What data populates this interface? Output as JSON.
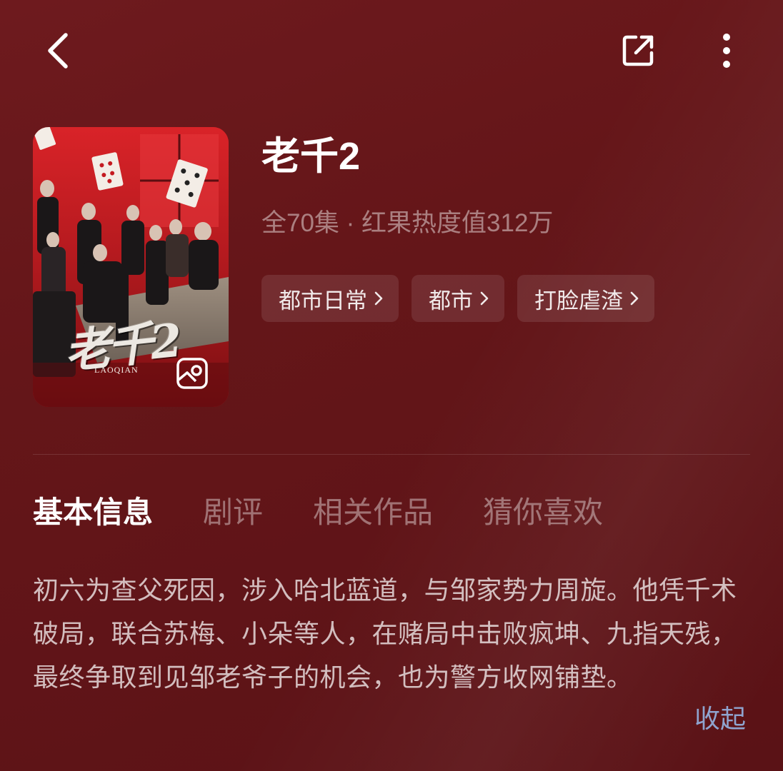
{
  "header": {
    "back_icon": "chevron-left-icon",
    "share_icon": "share-icon",
    "more_icon": "more-vertical-icon"
  },
  "poster": {
    "title_art": "老千2",
    "subtitle_art": "LAOQIAN",
    "gallery_icon": "image-gallery-icon"
  },
  "drama": {
    "title": "老千2",
    "meta": "全70集 · 红果热度值312万",
    "tags": [
      {
        "label": "都市日常"
      },
      {
        "label": "都市"
      },
      {
        "label": "打脸虐渣"
      }
    ]
  },
  "tabs": [
    {
      "label": "基本信息",
      "active": true
    },
    {
      "label": "剧评",
      "active": false
    },
    {
      "label": "相关作品",
      "active": false
    },
    {
      "label": "猜你喜欢",
      "active": false
    }
  ],
  "description": {
    "text": "初六为查父死因，涉入哈北蓝道，与邹家势力周旋。他凭千术破局，联合苏梅、小朵等人，在赌局中击败疯坤、九指天残，最终争取到见邹老爷子的机会，也为警方收网铺垫。",
    "collapse_label": "收起"
  },
  "colors": {
    "background": "#651619",
    "link": "#8fa4cf",
    "poster_red": "#c61e23"
  }
}
